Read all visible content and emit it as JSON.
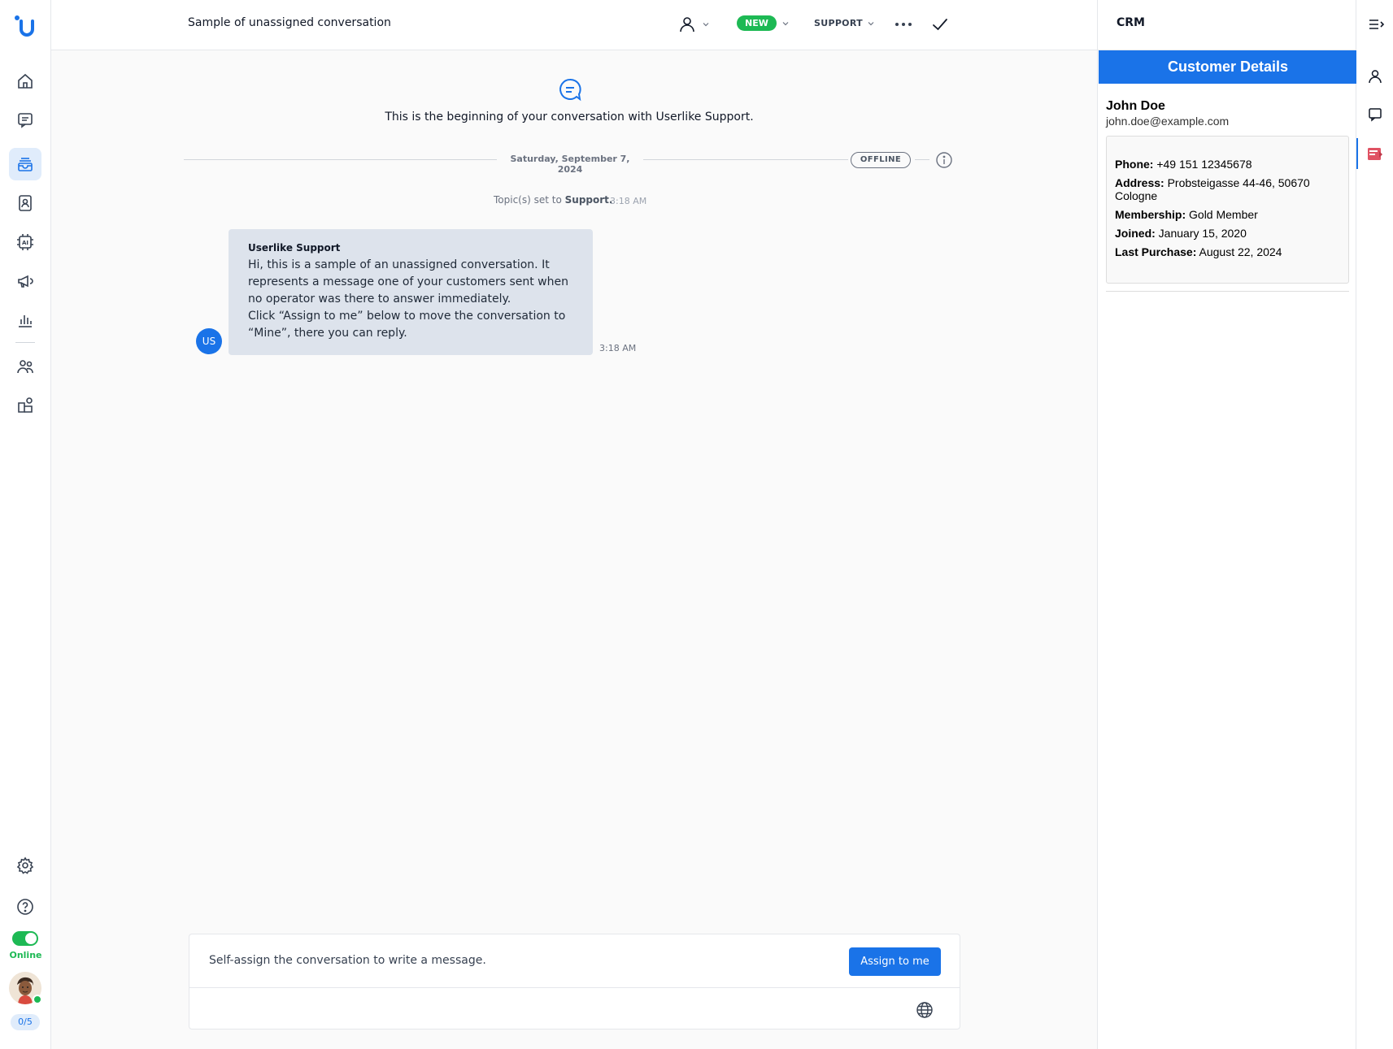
{
  "header": {
    "conversation_title": "Sample of unassigned conversation",
    "status_badge": "NEW",
    "topic_dropdown": "SUPPORT"
  },
  "chat": {
    "beginning_text": "This is the beginning of your conversation with Userlike Support.",
    "day_divider": "Saturday, September 7, 2024",
    "presence_badge": "OFFLINE",
    "topic_prefix": "Topic(s) set to",
    "topic_name": "Support.",
    "topic_time": "3:18 AM",
    "message": {
      "avatar_initials": "US",
      "sender": "Userlike Support",
      "body": "Hi, this is a sample of an unassigned conversation. It represents a message one of your customers sent when no operator was there to answer immediately.\nClick “Assign to me” below to move the conversation to “Mine”, there you can reply.",
      "time": "3:18 AM"
    }
  },
  "composer": {
    "notice": "Self-assign the conversation to write a message.",
    "assign_label": "Assign to me"
  },
  "leftnav": {
    "status_label": "Online",
    "capacity": "0/5",
    "items": [
      "home-icon",
      "conversations-icon",
      "inbox-icon",
      "contacts-icon",
      "ai-icon",
      "campaigns-icon",
      "analytics-icon",
      "team-icon",
      "integrations-icon",
      "settings-icon",
      "help-icon"
    ]
  },
  "crm": {
    "title": "CRM",
    "banner": "Customer Details",
    "customer": {
      "name": "John Doe",
      "email": "john.doe@example.com",
      "fields": [
        {
          "label": "Phone:",
          "value": "+49 151 12345678"
        },
        {
          "label": "Address:",
          "value": "Probsteigasse 44-46, 50670 Cologne"
        },
        {
          "label": "Membership:",
          "value": "Gold Member"
        },
        {
          "label": "Joined:",
          "value": "January 15, 2020"
        },
        {
          "label": "Last Purchase:",
          "value": "August 22, 2024"
        }
      ]
    }
  },
  "colors": {
    "accent": "#1a73e8",
    "online_green": "#1db954",
    "bubble": "#dde3ec",
    "crm_icon_red": "#e05263"
  }
}
